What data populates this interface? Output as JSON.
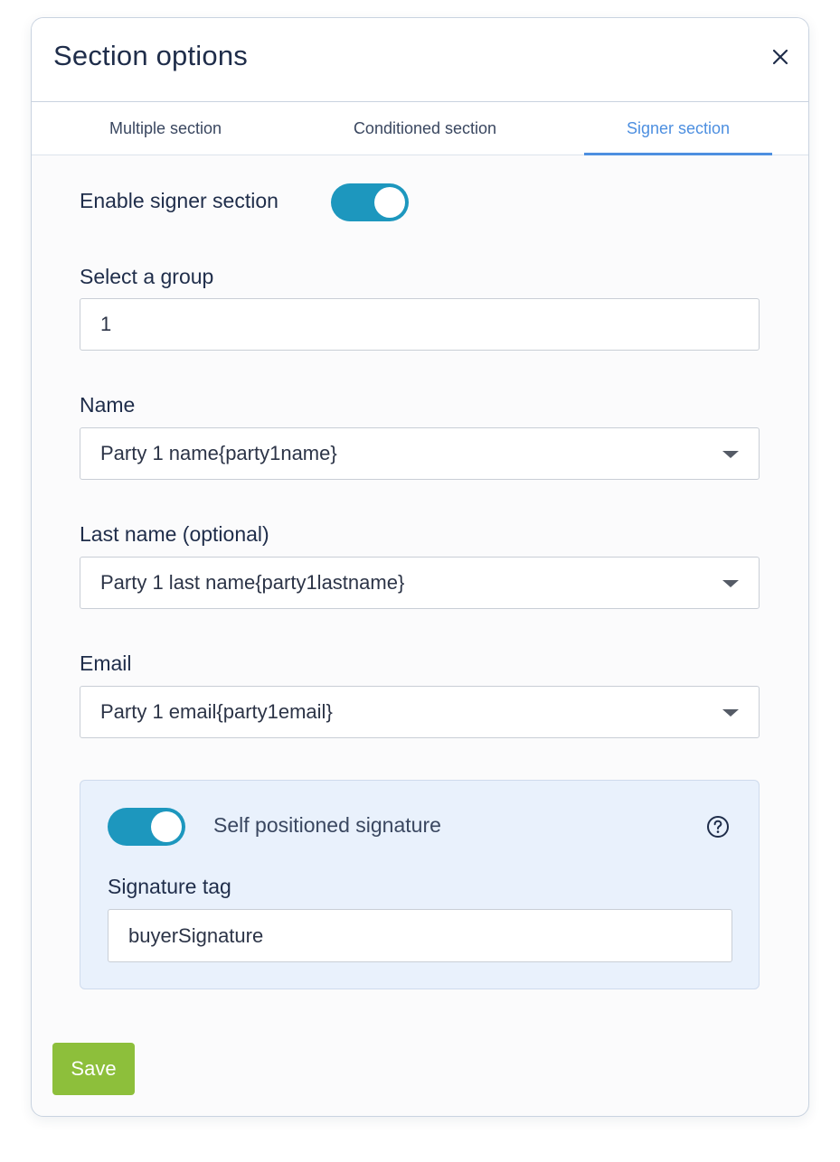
{
  "modal": {
    "title": "Section options",
    "close_icon": "close-icon"
  },
  "tabs": [
    {
      "label": "Multiple section",
      "active": false
    },
    {
      "label": "Conditioned section",
      "active": false
    },
    {
      "label": "Signer section",
      "active": true
    }
  ],
  "signer": {
    "enable_label": "Enable signer section",
    "enabled": true,
    "group_label": "Select a group",
    "group_value": "1",
    "name_label": "Name",
    "name_value": "Party 1 name{party1name}",
    "lastname_label": "Last name (optional)",
    "lastname_value": "Party 1 last name{party1lastname}",
    "email_label": "Email",
    "email_value": "Party 1 email{party1email}",
    "self_positioned_label": "Self positioned signature",
    "self_positioned": true,
    "tag_label": "Signature tag",
    "tag_value": "buyerSignature"
  },
  "footer": {
    "save_label": "Save"
  },
  "colors": {
    "accent": "#4d8fe0",
    "toggle_on": "#1d97be",
    "save": "#8dbf3b",
    "signature_box": "#e9f1fc"
  }
}
